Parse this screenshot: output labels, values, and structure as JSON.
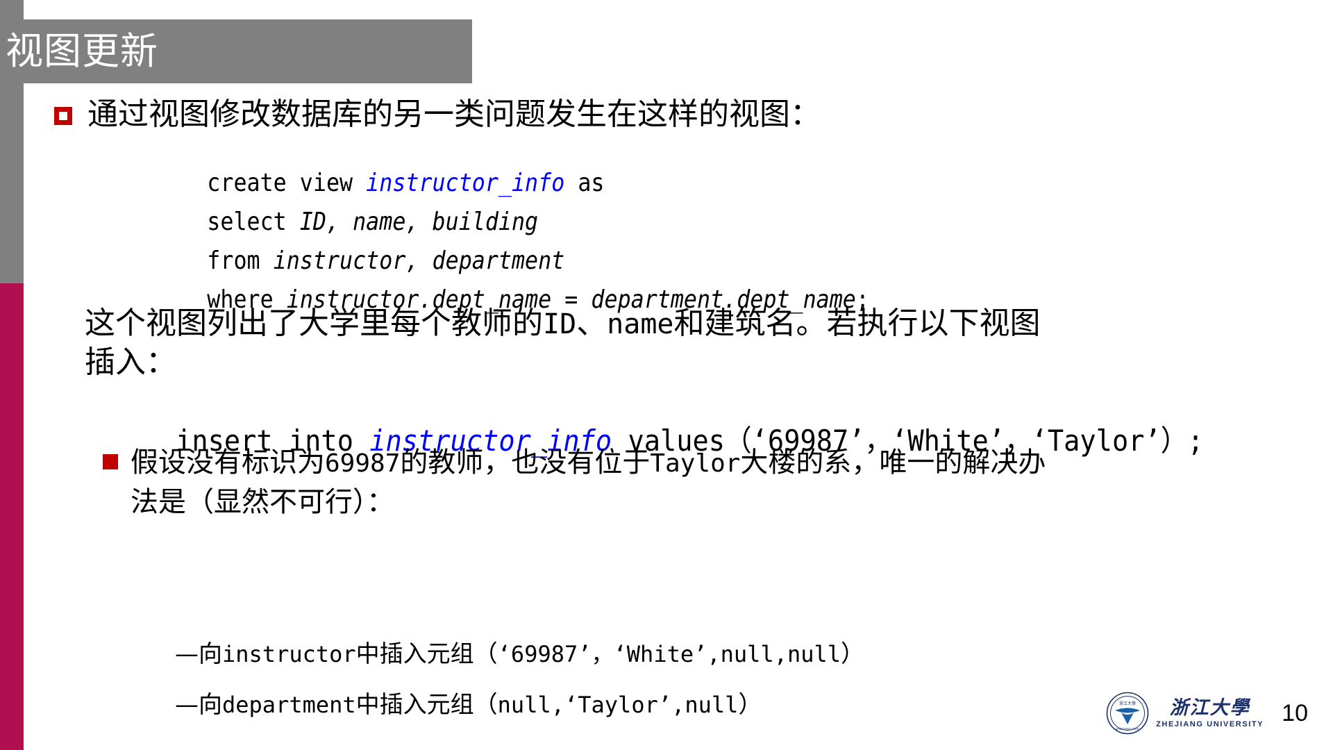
{
  "slide": {
    "title": "视图更新",
    "page_number": "10",
    "accent_gray": "#808080",
    "accent_crimson": "#b01050",
    "bullet_red": "#c00000",
    "identifier_blue": "#0000ff"
  },
  "bullet1": {
    "marker": "hollow-red-square",
    "text": "通过视图修改数据库的另一类问题发生在这样的视图："
  },
  "code_block": {
    "lines": [
      {
        "parts": [
          {
            "text": "create view ",
            "style": "keyword"
          },
          {
            "text": "instructor_info",
            "style": "identifier"
          },
          {
            "text": " as",
            "style": "keyword"
          }
        ]
      },
      {
        "parts": [
          {
            "text": "select ",
            "style": "keyword"
          },
          {
            "text": "ID, name, building",
            "style": "italic"
          }
        ]
      },
      {
        "parts": [
          {
            "text": "from ",
            "style": "keyword"
          },
          {
            "text": "instructor, department",
            "style": "italic"
          }
        ]
      },
      {
        "parts": [
          {
            "text": "where ",
            "style": "keyword"
          },
          {
            "text": "instructor.dept_name = department.dept_name",
            "style": "italic"
          },
          {
            "text": ";",
            "style": "plain"
          }
        ]
      }
    ]
  },
  "paragraph": {
    "line1_pre": "这个视图列出了大学里每个教师的",
    "line1_mono1": "ID",
    "line1_mid": "、",
    "line1_mono2": "name",
    "line1_post": "和建筑名。若执行以下视图",
    "line2": "插入："
  },
  "insert_statement": {
    "pre": "insert into ",
    "identifier": "instructor_info",
    "post": " values（‘69987’，‘White’，‘Taylor’）;"
  },
  "bullet2": {
    "marker": "filled-red-square",
    "pre": "假设没有标识为",
    "mono1": "69987",
    "mid": "的教师，也没有位于",
    "mono2": "Taylor",
    "post": "大楼的系，唯一的解决办法是（显然不可行）："
  },
  "sub_items": [
    {
      "dash": "—",
      "pre": "向",
      "mono1": "instructor",
      "mid": "中插入元组（",
      "mono2": "‘69987’，‘White’,null,null",
      "post": "）"
    },
    {
      "dash": "—",
      "pre": "向",
      "mono1": "department",
      "mid": "中插入元组（",
      "mono2": "null,‘Taylor’,null",
      "post": "）"
    }
  ],
  "footer": {
    "logo_cn": "浙江大學",
    "logo_en": "ZHEJIANG UNIVERSITY",
    "seal_text": "ZHEJIANG UNIVERSITY"
  }
}
